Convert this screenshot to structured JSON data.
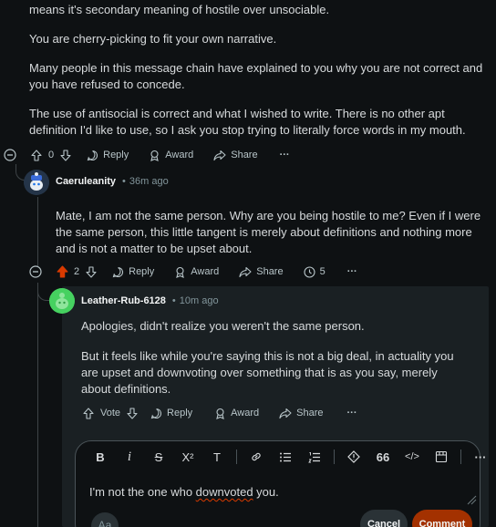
{
  "comment1": {
    "paragraphs": [
      "means it's secondary meaning of hostile over unsociable.",
      "You are cherry-picking to fit your own narrative.",
      "Many people in this message chain have explained to you why you are not correct and you have refused to concede.",
      "The use of antisocial is correct and what I wished to write. There is no other apt definition I'd like to use, so I ask you stop trying to literally force words in my mouth."
    ],
    "actions": {
      "vote_count": "0",
      "reply": "Reply",
      "award": "Award",
      "share": "Share",
      "more": "···"
    }
  },
  "comment2": {
    "username": "Caeruleanity",
    "time": "36m ago",
    "separator": "•",
    "paragraphs": [
      "Mate, I am not the same person. Why are you being hostile to me? Even if I were the same person, this little tangent is merely about definitions and nothing more and is not a matter to be upset about."
    ],
    "actions": {
      "vote_count": "2",
      "reply": "Reply",
      "award": "Award",
      "share": "Share",
      "views": "5",
      "more": "···"
    },
    "upvote_color": "#d93a00"
  },
  "comment3": {
    "username": "Leather-Rub-6128",
    "time": "10m ago",
    "separator": "•",
    "paragraphs": [
      "Apologies, didn't realize you weren't the same person.",
      "But it feels like while you're saying this is not a big deal, in actuality you are upset and downvoting over something that is as you say, merely about definitions."
    ],
    "actions": {
      "vote": "Vote",
      "reply": "Reply",
      "award": "Award",
      "share": "Share",
      "more": "···"
    }
  },
  "editor": {
    "toolbar": [
      "B",
      "i",
      "S",
      "X²",
      "T",
      "link",
      "bullets",
      "numbers",
      "spoiler",
      "66",
      "</>",
      "table",
      "···"
    ],
    "text_before": "I'm not the one who ",
    "text_misspelled": "downvoted",
    "text_after": " you.",
    "cancel": "Cancel",
    "comment": "Comment",
    "font_button": "Aa"
  },
  "colors": {
    "accent": "#d93a00",
    "comment_button": "#a33100",
    "background": "#0e1113",
    "panel": "#1a2023"
  }
}
